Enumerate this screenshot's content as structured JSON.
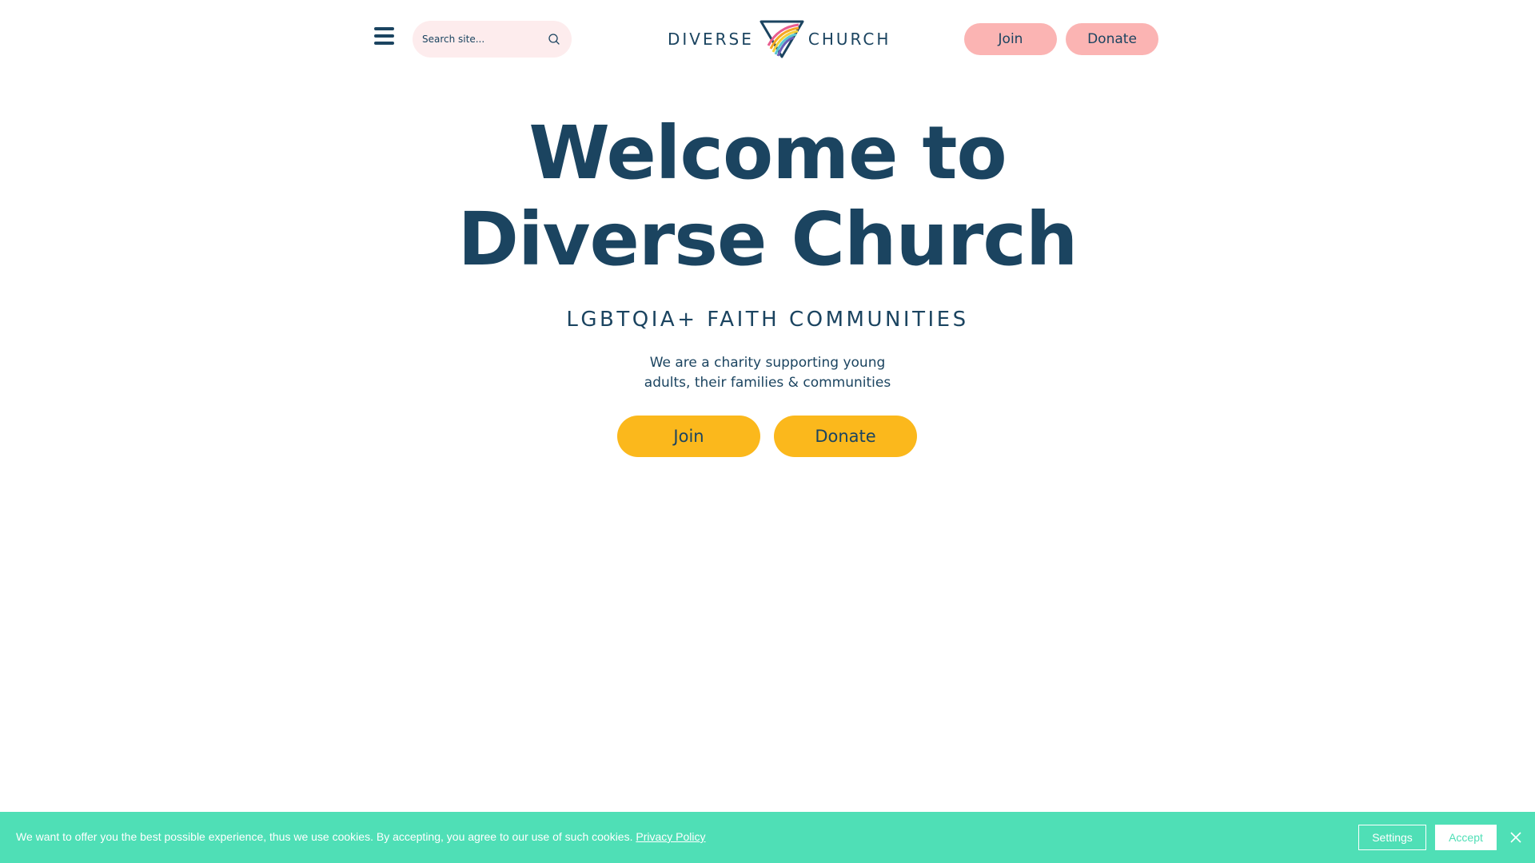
{
  "header": {
    "search_placeholder": "Search site...",
    "logo_left": "DIVERSE",
    "logo_right": "CHURCH",
    "join_label": "Join",
    "donate_label": "Donate"
  },
  "hero": {
    "title_line1": "Welcome to",
    "title_line2": "Diverse Church",
    "subtitle": "LGBTQIA+ FAITH COMMUNITIES",
    "desc_line1": "We are a charity supporting young",
    "desc_line2": "adults, their families & communities",
    "join_label": "Join",
    "donate_label": "Donate"
  },
  "cookie": {
    "message": "We want to offer you the best possible experience, thus we use cookies. By accepting, you agree to our use of such cookies.",
    "policy_link": "Privacy Policy",
    "settings_label": "Settings",
    "accept_label": "Accept"
  },
  "colors": {
    "primary": "#1b4460",
    "pink_button": "#fbb4b3",
    "search_bg": "#fdeced",
    "yellow_button": "#fbb81c",
    "cookie_bg": "#4fdfb6"
  },
  "icons": {
    "menu": "hamburger-icon",
    "search": "search-icon",
    "logo": "rainbow-triangle-logo",
    "close": "close-icon"
  }
}
